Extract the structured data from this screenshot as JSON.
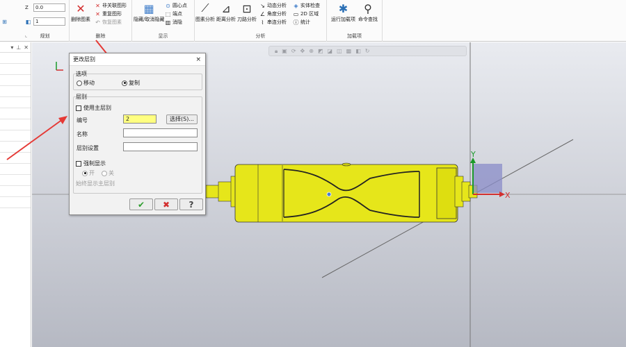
{
  "ribbon": {
    "z_label": "Z",
    "z_value": "0.0",
    "layer_value": "1",
    "groups": {
      "planning": "规划",
      "delete": "删除",
      "display": "显示",
      "analysis": "分析",
      "addins": "加载项"
    },
    "delete_entity": "删除图素",
    "unassociate": "非关联图形",
    "repeat_shape": "重复图形",
    "restore_shape": "恢复图素",
    "hide_unhide": "隐藏/取消隐藏",
    "center_point": "圆心点",
    "point": "端点",
    "elimination": "消隐",
    "entity_analysis": "图素分析",
    "distance_analysis": "距离分析",
    "toolpath_analysis": "刀路分析",
    "dynamic_analysis": "动态分析",
    "angle_analysis": "角度分析",
    "chain_analysis": "串连分析",
    "solid_check": "实体检查",
    "region_2d": "2D 区域",
    "statistics": "统计",
    "run_addin": "运行加载项",
    "command_find": "命令查找"
  },
  "viewport": {
    "axis_x": "X",
    "axis_y": "Y"
  },
  "dialog": {
    "title": "更改层别",
    "close": "×",
    "options_group": "选项",
    "move": "移动",
    "copy": "复制",
    "layer_group": "层别",
    "use_main_layer": "使用主层别",
    "number_label": "编号",
    "number_value": "2",
    "select_button": "选择(S)...",
    "name_label": "名称",
    "name_value": "",
    "layer_setting_label": "层别设置",
    "layer_setting_value": "",
    "force_display": "强制显示",
    "on": "开",
    "off": "关",
    "always_show_main": "始终显示主层别",
    "ok_icon": "check-icon",
    "cancel_icon": "x-icon",
    "help_icon": "help-icon"
  },
  "colors": {
    "part": "#e6e61a",
    "arrow": "#e53935",
    "dialog_input_highlight": "#ffff80"
  }
}
